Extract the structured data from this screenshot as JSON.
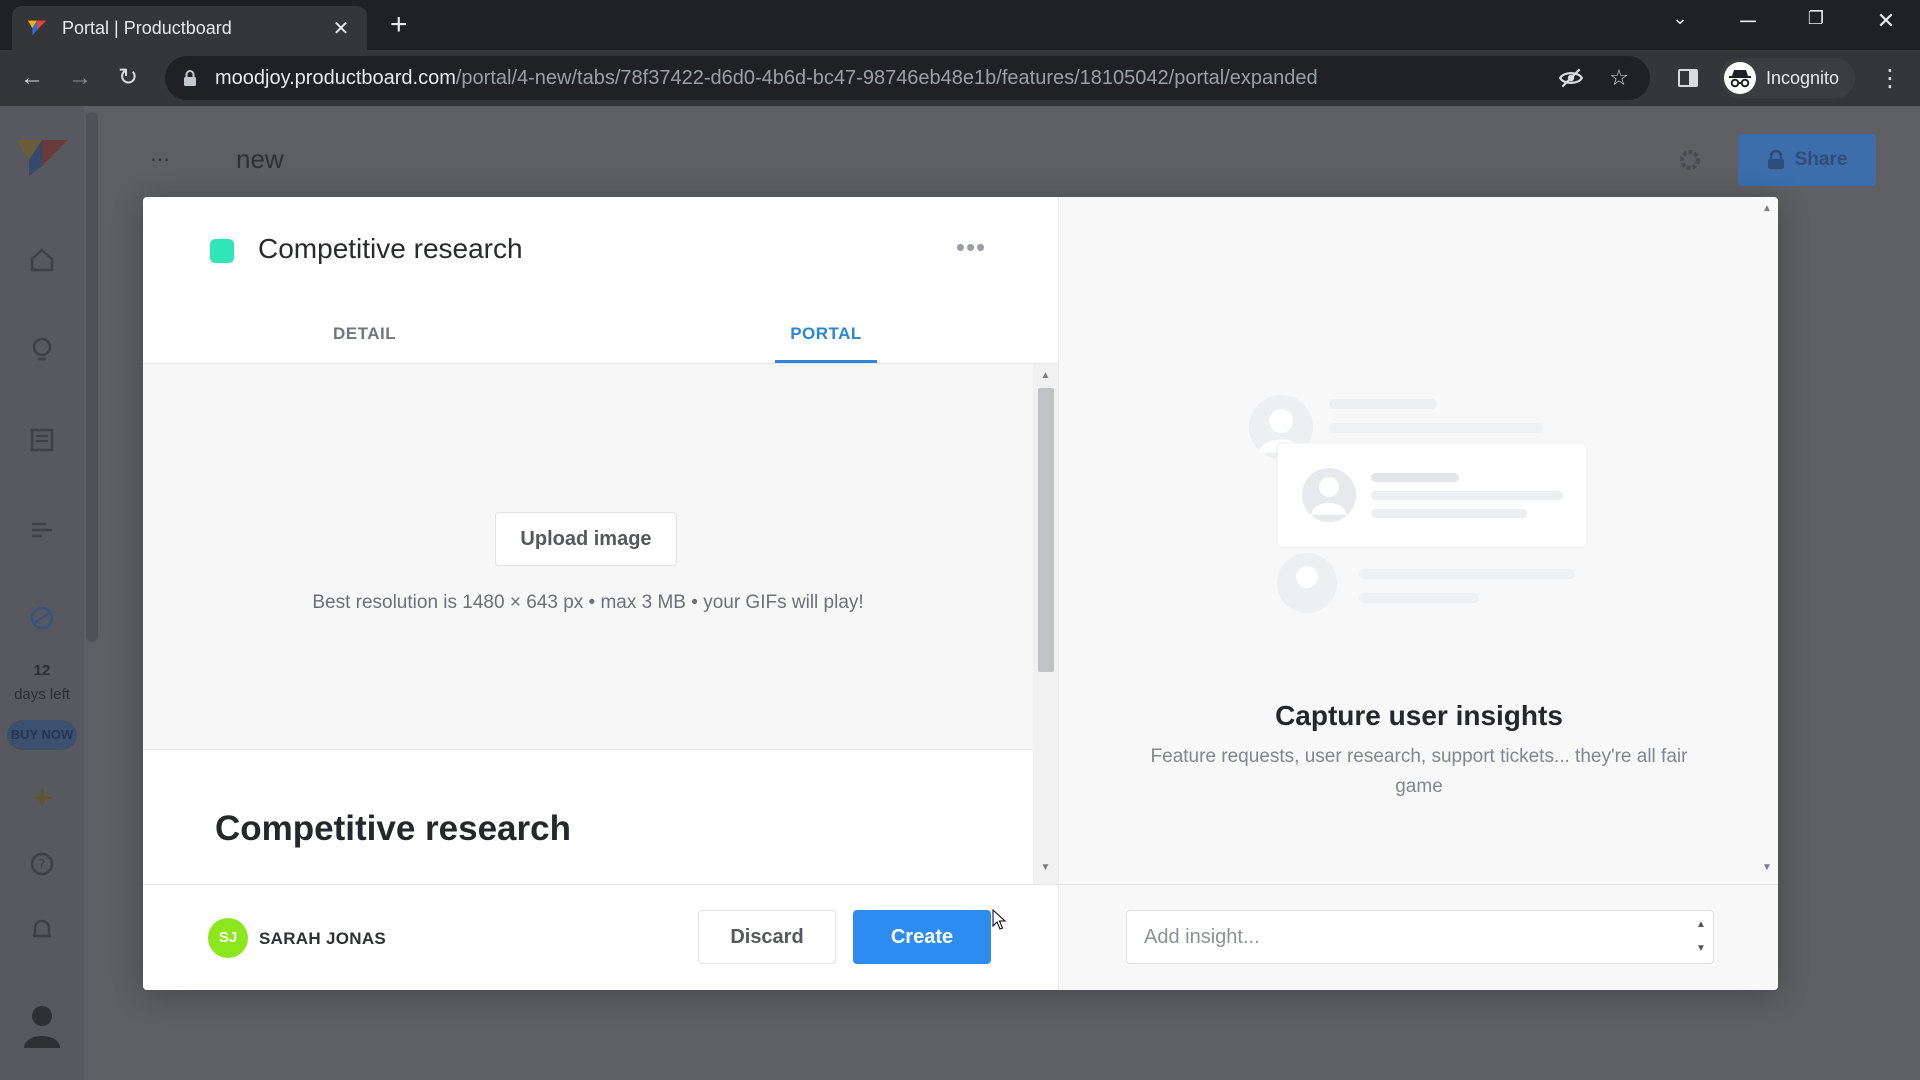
{
  "browser": {
    "tab_title": "Portal | Productboard",
    "url_host": "moodjoy.productboard.com",
    "url_path": "/portal/4-new/tabs/78f37422-d6d0-4b6d-bc47-98746eb48e1b/features/18105042/portal/expanded",
    "profile_label": "Incognito"
  },
  "background_app": {
    "breadcrumb_prefix": "...",
    "board_name": "new",
    "share_label": "Share",
    "trial_days": "12",
    "trial_label": "days left",
    "buy_now_label": "BUY NOW"
  },
  "modal": {
    "feature_title": "Competitive research",
    "feature_color": "#2ee6b8",
    "more_menu": "•••",
    "tabs": [
      {
        "label": "DETAIL",
        "active": false
      },
      {
        "label": "PORTAL",
        "active": true
      }
    ],
    "upload": {
      "button_label": "Upload image",
      "hint": "Best resolution is 1480 × 643 px • max 3 MB • your GIFs will play!"
    },
    "content_title": "Competitive research",
    "author": {
      "initials": "SJ",
      "name": "SARAH JONAS",
      "avatar_color": "#8ce81c"
    },
    "discard_label": "Discard",
    "create_label": "Create",
    "insights": {
      "title": "Capture user insights",
      "subtitle": "Feature requests, user research, support tickets... they're all fair game",
      "input_placeholder": "Add insight..."
    }
  },
  "colors": {
    "accent": "#2d8cf0",
    "tab_active": "#2a86d8"
  }
}
